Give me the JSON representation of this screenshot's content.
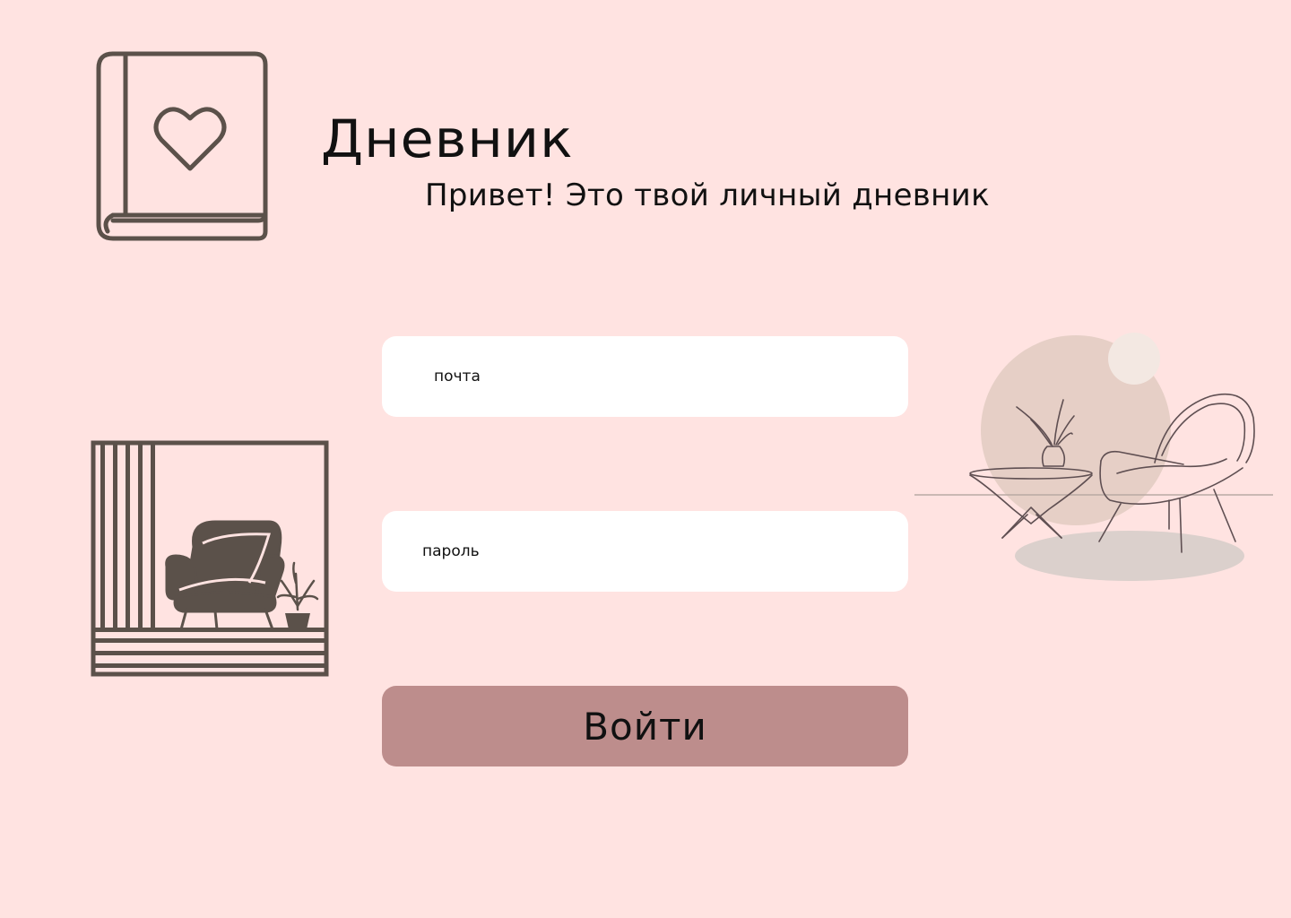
{
  "header": {
    "title": "Дневник",
    "subtitle": "Привет! Это твой личный дневник"
  },
  "login_form": {
    "email_placeholder": "почта",
    "password_placeholder": "пароль",
    "submit_label": "Войти"
  },
  "icons": {
    "logo": "diary-heart-icon",
    "left_illustration": "armchair-window-illustration",
    "right_illustration": "lounge-chair-table-illustration"
  },
  "colors": {
    "background": "#ffe3e1",
    "button": "#bd8d8c",
    "input_background": "#ffffff",
    "icon_stroke": "#5b514a"
  }
}
